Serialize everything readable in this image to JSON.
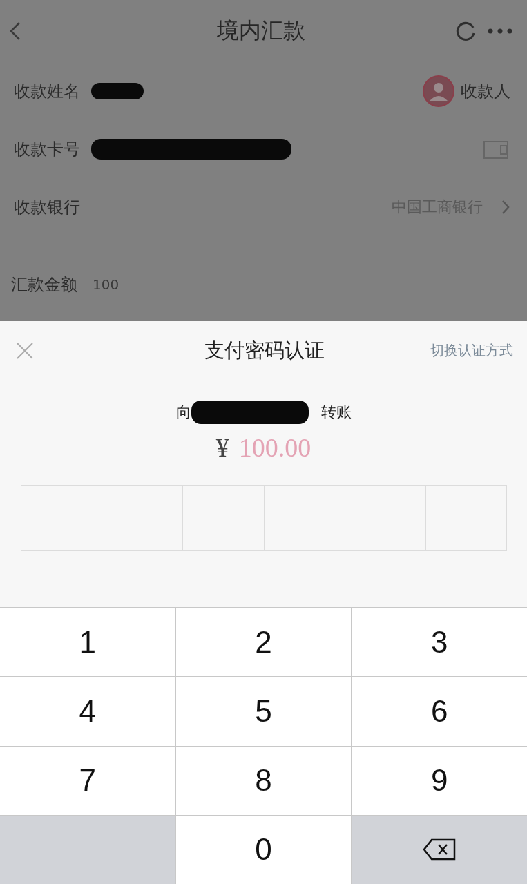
{
  "nav": {
    "title": "境内汇款"
  },
  "form": {
    "rows": [
      {
        "kind": "name",
        "label": "收款姓名",
        "redacted": true,
        "action": "收款人"
      },
      {
        "kind": "card",
        "label": "收款卡号",
        "redacted": true
      },
      {
        "kind": "bank",
        "label": "收款银行",
        "value": "中国工商银行"
      },
      {
        "kind": "amount",
        "label": "汇款金额",
        "value": "100"
      }
    ]
  },
  "sheet": {
    "title": "支付密码认证",
    "switch_link": "切换认证方式",
    "payee_prefix": "向",
    "payee_redacted": true,
    "payee_suffix": "转账",
    "currency": "¥",
    "amount": "100.00",
    "pin_boxes": [
      {
        "filled": false
      },
      {
        "filled": false
      },
      {
        "filled": false
      },
      {
        "filled": false
      },
      {
        "filled": false
      },
      {
        "filled": false
      }
    ]
  },
  "keypad": [
    {
      "kind": "digit",
      "label": "1"
    },
    {
      "kind": "digit",
      "label": "2"
    },
    {
      "kind": "digit",
      "label": "3"
    },
    {
      "kind": "digit",
      "label": "4"
    },
    {
      "kind": "digit",
      "label": "5"
    },
    {
      "kind": "digit",
      "label": "6"
    },
    {
      "kind": "digit",
      "label": "7"
    },
    {
      "kind": "digit",
      "label": "8"
    },
    {
      "kind": "digit",
      "label": "9"
    },
    {
      "kind": "blank"
    },
    {
      "kind": "digit",
      "label": "0"
    },
    {
      "kind": "delete"
    }
  ]
}
